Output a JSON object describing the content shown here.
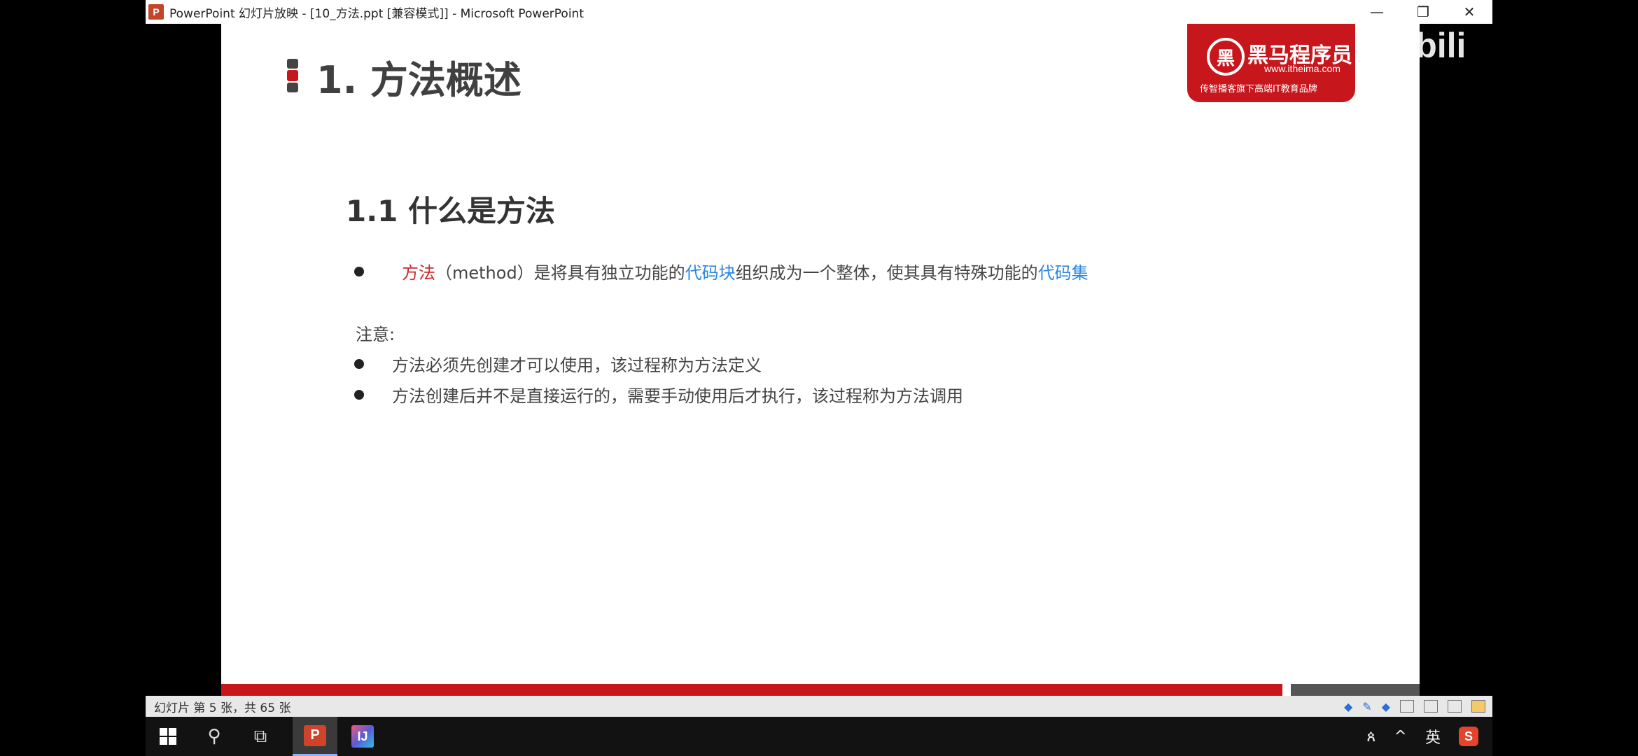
{
  "window": {
    "title": "PowerPoint 幻灯片放映 - [10_方法.ppt [兼容模式]] - Microsoft PowerPoint",
    "app_icon": "P",
    "minimize": "—",
    "restore": "❐",
    "close": "✕"
  },
  "slide": {
    "title": "1. 方法概述",
    "logo": {
      "name": "黑马程序员",
      "emblem": "黑",
      "url": "www.itheima.com",
      "slogan": "传智播客旗下高端IT教育品牌"
    },
    "subtitle": "1.1 什么是方法",
    "definition": {
      "term": "方法",
      "part1": "（method）是将具有独立功能的",
      "term2": "代码块",
      "part2": "组织成为一个整体，使其具有特殊功能的",
      "term3": "代码集"
    },
    "note_label": "注意:",
    "notes": [
      "方法必须先创建才可以使用，该过程称为方法定义",
      "方法创建后并不是直接运行的，需要手动使用后才执行，该过程称为方法调用"
    ]
  },
  "overlay_logo": "bilibili",
  "statusbar": {
    "slide_info": "幻灯片 第 5 张，共 65 张"
  },
  "taskbar": {
    "search_glyph": "⚲",
    "taskview_glyph": "⧉",
    "ppt_label": "P",
    "idea_label": "IJ",
    "tray_user": "ጰ",
    "tray_chevron": "^",
    "ime": "英",
    "sogou": "S"
  },
  "colors": {
    "brand_red": "#c8161d",
    "highlight_blue": "#2b86e0",
    "term_red": "#d02a2a"
  }
}
